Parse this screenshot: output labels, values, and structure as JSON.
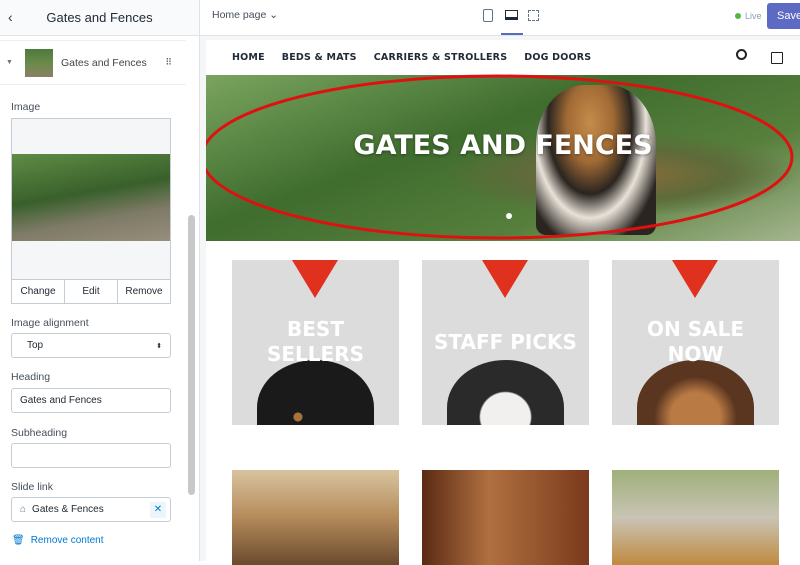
{
  "sidebar": {
    "title": "Gates and Fences",
    "block_title": "Gates and Fences",
    "image_label": "Image",
    "buttons": [
      "Change",
      "Edit",
      "Remove"
    ],
    "alignment_label": "Image alignment",
    "alignment_value": "Top",
    "heading_label": "Heading",
    "heading_value": "Gates and Fences",
    "subheading_label": "Subheading",
    "subheading_value": "",
    "slide_link_label": "Slide link",
    "slide_link_value": "Gates & Fences",
    "remove_content": "Remove content"
  },
  "topbar": {
    "page_select": "Home page",
    "status": "Live",
    "save": "Save",
    "status_color": "#50b83c",
    "accent": "#5c6ac4"
  },
  "store": {
    "nav": [
      "HOME",
      "BEDS & MATS",
      "CARRIERS & STROLLERS",
      "DOG DOORS"
    ],
    "hero_title": "GATES AND FENCES",
    "tiles": [
      [
        "BEST",
        "SELLERS"
      ],
      [
        "STAFF PICKS"
      ],
      [
        "ON SALE",
        "NOW"
      ]
    ]
  }
}
